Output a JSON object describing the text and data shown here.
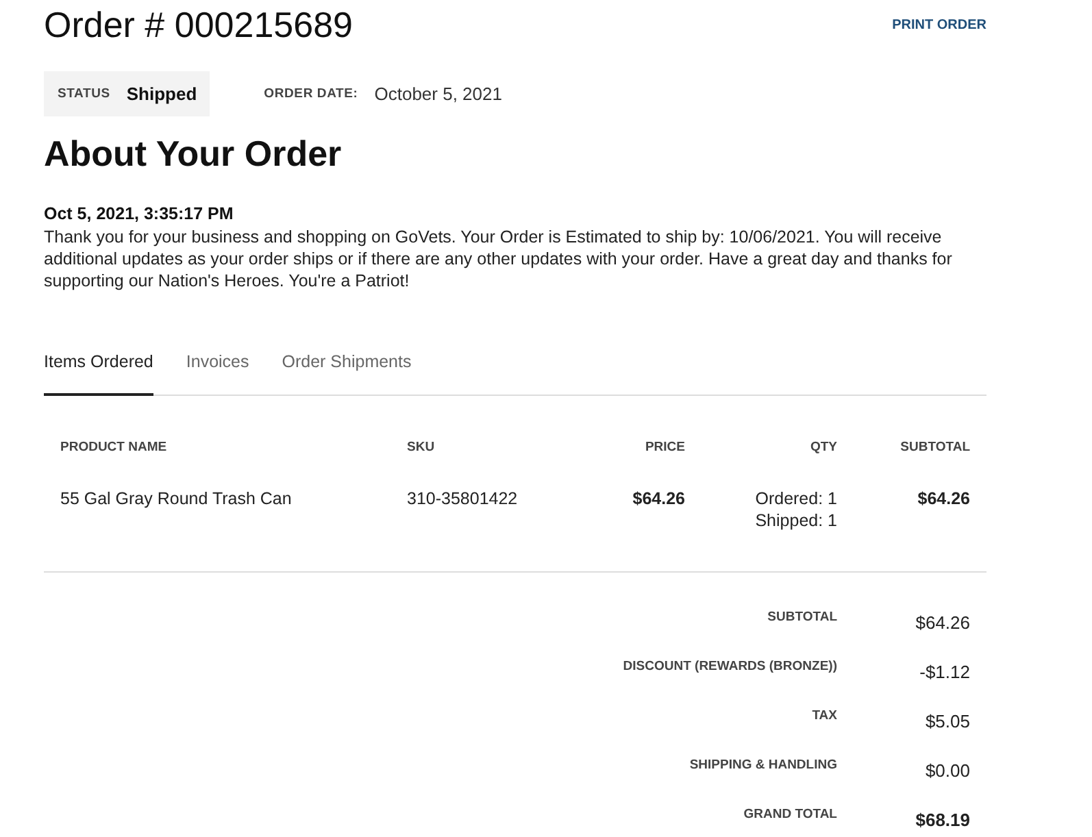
{
  "order": {
    "title": "Order # 000215689",
    "print_link": "PRINT ORDER",
    "status_label": "STATUS",
    "status_value": "Shipped",
    "date_label": "ORDER DATE:",
    "date_value": "October 5, 2021"
  },
  "about": {
    "heading": "About Your Order",
    "timestamp": "Oct 5, 2021, 3:35:17 PM",
    "message": "Thank you for your business and shopping on GoVets. Your Order is Estimated to ship by: 10/06/2021. You will receive additional updates as your order ships or if there are any other updates with your order. Have a great day and thanks for supporting our Nation's Heroes. You're a Patriot!"
  },
  "tabs": [
    {
      "label": "Items Ordered",
      "selected": true
    },
    {
      "label": "Invoices",
      "selected": false
    },
    {
      "label": "Order Shipments",
      "selected": false
    }
  ],
  "table": {
    "columns": [
      "PRODUCT NAME",
      "SKU",
      "PRICE",
      "QTY",
      "SUBTOTAL"
    ],
    "rows": [
      {
        "product_name": "55 Gal Gray Round Trash Can",
        "sku": "310-35801422",
        "price": "$64.26",
        "qty": [
          "Ordered: 1",
          "Shipped: 1"
        ],
        "subtotal": "$64.26"
      }
    ]
  },
  "totals": [
    {
      "kind": "line",
      "label": "SUBTOTAL",
      "value": "$64.26"
    },
    {
      "kind": "line",
      "label": "DISCOUNT (REWARDS (BRONZE))",
      "value": "-$1.12"
    },
    {
      "kind": "line",
      "label": "TAX",
      "value": "$5.05"
    },
    {
      "kind": "line",
      "label": "SHIPPING & HANDLING",
      "value": "$0.00"
    },
    {
      "kind": "grand",
      "label": "GRAND TOTAL",
      "value": "$68.19"
    }
  ]
}
